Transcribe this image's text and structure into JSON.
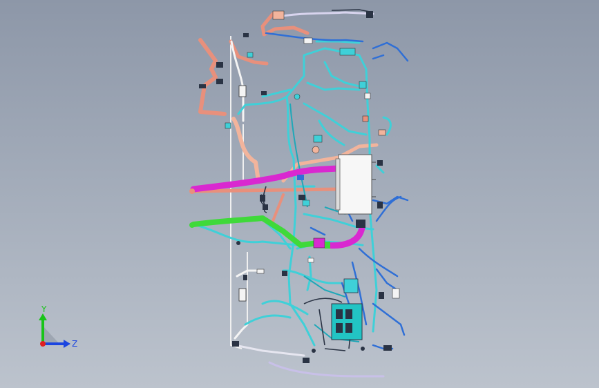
{
  "viewport": {
    "background_top": "#8d97a8",
    "background_bottom": "#bcc3cd"
  },
  "model": {
    "colors": {
      "cyan": "#3fd0d8",
      "cyan_dark": "#1fa8b8",
      "blue": "#2f6fd6",
      "salmon": "#e8907c",
      "peach": "#f2b49c",
      "magenta": "#d928d0",
      "green": "#3fd93a",
      "white_tube": "#f4f4f4",
      "connector_dark": "#2a3344",
      "connector_teal": "#22c4c4",
      "lavender": "#c8c0e8"
    }
  },
  "triad": {
    "y_label": "Y",
    "z_label": "Z",
    "y_color": "#19c419",
    "z_color": "#1b45e0",
    "x_color": "#e02020"
  }
}
